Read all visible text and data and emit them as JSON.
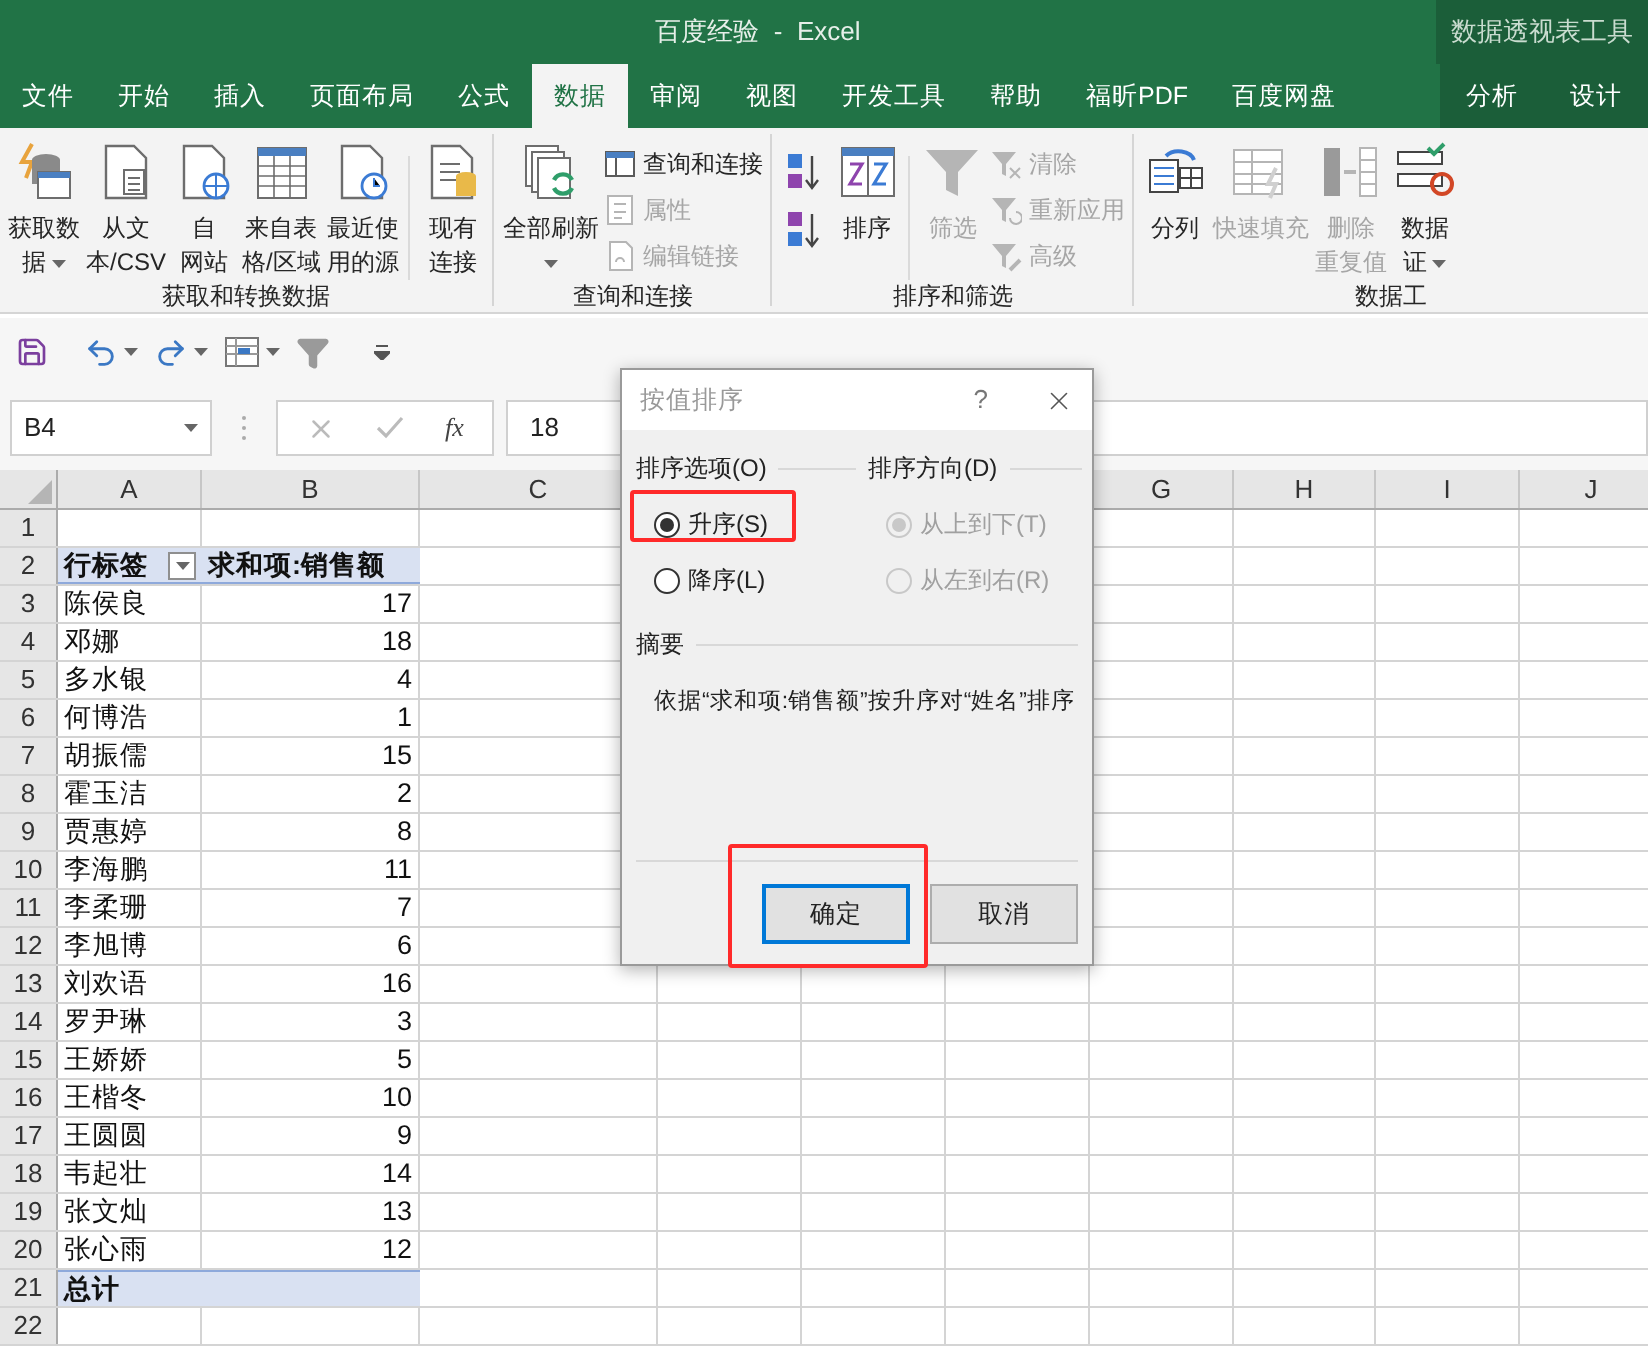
{
  "window": {
    "title": "百度经验  -  Excel",
    "context_title": "数据透视表工具"
  },
  "tabs": [
    {
      "label": "文件",
      "selected": false,
      "kind": "standard"
    },
    {
      "label": "开始",
      "selected": false,
      "kind": "standard"
    },
    {
      "label": "插入",
      "selected": false,
      "kind": "standard"
    },
    {
      "label": "页面布局",
      "selected": false,
      "kind": "standard"
    },
    {
      "label": "公式",
      "selected": false,
      "kind": "standard"
    },
    {
      "label": "数据",
      "selected": true,
      "kind": "standard"
    },
    {
      "label": "审阅",
      "selected": false,
      "kind": "standard"
    },
    {
      "label": "视图",
      "selected": false,
      "kind": "standard"
    },
    {
      "label": "开发工具",
      "selected": false,
      "kind": "standard"
    },
    {
      "label": "帮助",
      "selected": false,
      "kind": "standard"
    },
    {
      "label": "福昕PDF",
      "selected": false,
      "kind": "standard"
    },
    {
      "label": "百度网盘",
      "selected": false,
      "kind": "standard"
    },
    {
      "label": "分析",
      "selected": false,
      "kind": "contextual"
    },
    {
      "label": "设计",
      "selected": false,
      "kind": "contextual"
    }
  ],
  "ribbon": {
    "groups": [
      {
        "label": "获取和转换数据",
        "items": [
          {
            "kind": "large",
            "lines": [
              "获取数",
              "据"
            ],
            "dropdown": true,
            "disabled": false
          },
          {
            "kind": "large",
            "lines": [
              "从文",
              "本/CSV"
            ],
            "disabled": false
          },
          {
            "kind": "large",
            "lines": [
              "自",
              "网站"
            ],
            "disabled": false
          },
          {
            "kind": "large",
            "lines": [
              "来自表",
              "格/区域"
            ],
            "disabled": false
          },
          {
            "kind": "large",
            "lines": [
              "最近使",
              "用的源"
            ],
            "disabled": false
          },
          {
            "kind": "separator"
          },
          {
            "kind": "large",
            "lines": [
              "现有",
              "连接"
            ],
            "disabled": false
          }
        ]
      },
      {
        "label": "查询和连接",
        "items": [
          {
            "kind": "large",
            "lines": [
              "全部刷新"
            ],
            "dropdown": true,
            "disabled": false
          },
          {
            "kind": "stack",
            "items": [
              {
                "label": "查询和连接",
                "disabled": false
              },
              {
                "label": "属性",
                "disabled": true
              },
              {
                "label": "编辑链接",
                "disabled": true
              }
            ]
          }
        ]
      },
      {
        "label": "排序和筛选",
        "items": [
          {
            "kind": "sort-pair"
          },
          {
            "kind": "large",
            "lines": [
              "排序"
            ],
            "disabled": false
          },
          {
            "kind": "separator"
          },
          {
            "kind": "large",
            "lines": [
              "筛选"
            ],
            "disabled": true
          },
          {
            "kind": "stack",
            "items": [
              {
                "label": "清除",
                "disabled": true
              },
              {
                "label": "重新应用",
                "disabled": true
              },
              {
                "label": "高级",
                "disabled": true
              }
            ]
          }
        ]
      },
      {
        "label": "数据工",
        "items": [
          {
            "kind": "large",
            "lines": [
              "分列"
            ],
            "disabled": false
          },
          {
            "kind": "large",
            "lines": [
              "快速填充"
            ],
            "disabled": true
          },
          {
            "kind": "large",
            "lines": [
              "删除",
              "重复值"
            ],
            "disabled": true
          },
          {
            "kind": "large",
            "lines": [
              "数据",
              "证"
            ],
            "dropdown": true,
            "disabled": false
          }
        ]
      }
    ]
  },
  "formula_bar": {
    "name_box": "B4",
    "function_button": "fx",
    "value": "18"
  },
  "sheet": {
    "columns_left": [
      "A",
      "B",
      "C"
    ],
    "columns_right": [
      "G",
      "H",
      "I",
      "J"
    ],
    "row_numbers": [
      "1",
      "2",
      "3",
      "4",
      "5",
      "6",
      "7",
      "8",
      "9",
      "10",
      "11",
      "12",
      "13",
      "14",
      "15",
      "16",
      "17",
      "18",
      "19",
      "20",
      "21",
      "22"
    ],
    "pivot": {
      "header": {
        "label": "行标签",
        "value": "求和项:销售额"
      },
      "rows": [
        {
          "name": "陈侯良",
          "value": "17"
        },
        {
          "name": "邓娜",
          "value": "18"
        },
        {
          "name": "多水银",
          "value": "4"
        },
        {
          "name": "何博浩",
          "value": "1"
        },
        {
          "name": "胡振儒",
          "value": "15"
        },
        {
          "name": "霍玉洁",
          "value": "2"
        },
        {
          "name": "贾惠婷",
          "value": "8"
        },
        {
          "name": "李海鹏",
          "value": "11"
        },
        {
          "name": "李柔珊",
          "value": "7"
        },
        {
          "name": "李旭博",
          "value": "6"
        },
        {
          "name": "刘欢语",
          "value": "16"
        },
        {
          "name": "罗尹琳",
          "value": "3"
        },
        {
          "name": "王娇娇",
          "value": "5"
        },
        {
          "name": "王楷冬",
          "value": "10"
        },
        {
          "name": "王圆圆",
          "value": "9"
        },
        {
          "name": "韦起壮",
          "value": "14"
        },
        {
          "name": "张文灿",
          "value": "13"
        },
        {
          "name": "张心雨",
          "value": "12"
        }
      ],
      "total": {
        "label": "总计"
      }
    }
  },
  "dialog": {
    "title": "按值排序",
    "help": "?",
    "sort_options": {
      "label": "排序选项(O)",
      "options": [
        {
          "label": "升序(S)",
          "selected": true,
          "annotated": true
        },
        {
          "label": "降序(L)",
          "selected": false,
          "annotated": false
        }
      ]
    },
    "sort_direction": {
      "label": "排序方向(D)",
      "options": [
        {
          "label": "从上到下(T)",
          "selected": true,
          "disabled": true
        },
        {
          "label": "从左到右(R)",
          "selected": false,
          "disabled": true
        }
      ]
    },
    "summary": {
      "label": "摘要",
      "text": "依据“求和项:销售额”按升序对“姓名”排序"
    },
    "buttons": [
      {
        "label": "确定",
        "default": true,
        "annotated": true
      },
      {
        "label": "取消",
        "default": false,
        "annotated": false
      }
    ]
  }
}
